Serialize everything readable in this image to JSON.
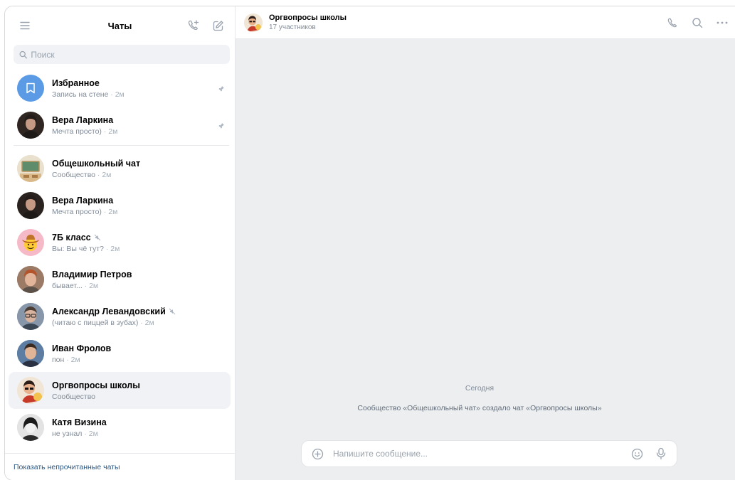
{
  "sidebar": {
    "title": "Чаты",
    "search_placeholder": "Поиск",
    "pinned": [
      {
        "name": "Избранное",
        "preview": "Запись на стене",
        "time": "· 2м",
        "avatar": "bookmark"
      },
      {
        "name": "Вера Ларкина",
        "preview": "Мечта просто)",
        "time": "· 2м",
        "avatar": "photo-dark"
      }
    ],
    "chats": [
      {
        "name": "Общешкольный чат",
        "preview": "Сообщество",
        "time": "· 2м",
        "avatar": "classroom",
        "muted": false
      },
      {
        "name": "Вера Ларкина",
        "preview": "Мечта просто)",
        "time": "· 2м",
        "avatar": "photo-dark",
        "muted": false
      },
      {
        "name": "7Б класс",
        "preview": "Вы: Вы чё тут?",
        "time": "· 2м",
        "avatar": "emoji-cowboy",
        "muted": true
      },
      {
        "name": "Владимир Петров",
        "preview": "бывает...",
        "time": "· 2м",
        "avatar": "photo-redhead",
        "muted": false
      },
      {
        "name": "Александр Левандовский",
        "preview": "(читаю с пиццей в зубах)",
        "time": "· 2м",
        "avatar": "photo-glasses",
        "muted": true
      },
      {
        "name": "Иван Фролов",
        "preview": "пон",
        "time": "· 2м",
        "avatar": "photo-man",
        "muted": false
      },
      {
        "name": "Оргвопросы школы",
        "preview": "Сообщество",
        "time": "",
        "avatar": "cartoon",
        "muted": false,
        "active": true
      },
      {
        "name": "Катя Визина",
        "preview": "не узнал",
        "time": "· 2м",
        "avatar": "photo-bw",
        "muted": false
      }
    ],
    "footer_link": "Показать непрочитанные чаты"
  },
  "conversation": {
    "title": "Оргвопросы школы",
    "subtitle": "17 участников",
    "date_label": "Сегодня",
    "system_message": "Сообщество «Общешкольный чат» создало чат «Оргвопросы школы»",
    "composer_placeholder": "Напишите сообщение..."
  },
  "colors": {
    "accent": "#4a7fd6",
    "favorites_avatar": "#5b9be6",
    "active_row": "#f0f2f5",
    "chat_background": "#edeef0",
    "icon_gray": "#99a2ad"
  }
}
